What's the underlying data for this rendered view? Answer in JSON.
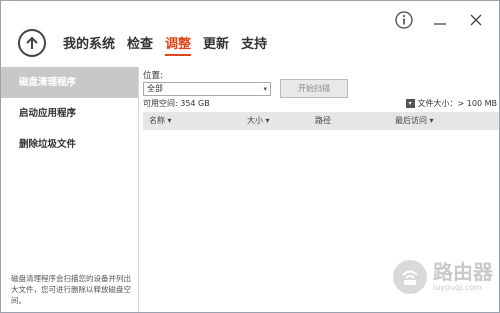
{
  "nav": {
    "items": [
      {
        "label": "我的系统"
      },
      {
        "label": "检查"
      },
      {
        "label": "调整",
        "active": true
      },
      {
        "label": "更新"
      },
      {
        "label": "支持"
      }
    ]
  },
  "sidebar": {
    "items": [
      {
        "label": "磁盘清理程序",
        "active": true
      },
      {
        "label": "启动应用程序"
      },
      {
        "label": "删除垃圾文件"
      }
    ],
    "description": "磁盘清理程序会扫描您的设备并列出大文件，您可进行删除以释放磁盘空间。"
  },
  "main": {
    "location_label": "位置:",
    "location_value": "全部",
    "scan_button": "开始扫描",
    "free_space": "可用空间: 354 GB",
    "filter_label": "文件大小：> 100 MB",
    "columns": [
      "名称 ▾",
      "大小 ▾",
      "路径",
      "最后访问 ▾"
    ]
  },
  "watermark": {
    "main": "路由器",
    "sub": "luyouqi.com"
  },
  "colors": {
    "accent": "#e2461a",
    "sidebar_active": "#c8c8c8"
  },
  "icons": {
    "back": "arrow-up-circle-icon",
    "info": "info-icon",
    "minimize": "minimize-icon",
    "close": "close-icon"
  }
}
